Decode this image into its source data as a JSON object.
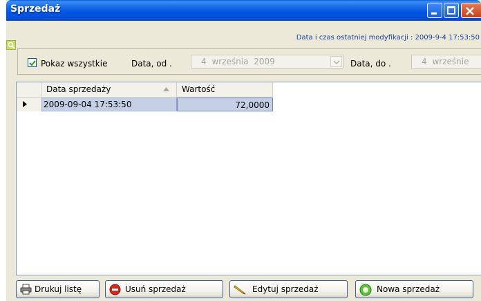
{
  "window": {
    "title": "Sprzedaż",
    "last_modified": "Data i czas ostatniej modyfikacji : 2009-9-4 17:53:50"
  },
  "filter": {
    "show_all_label": "Pokaz wszystkie",
    "show_all_checked": true,
    "date_from_label": "Data, od .",
    "date_from_value": "4 września 2009",
    "date_to_label": "Data, do .",
    "date_to_value": "4 wrześnie"
  },
  "grid": {
    "columns": [
      "Data sprzedaży",
      "Wartość"
    ],
    "rows": [
      {
        "date": "2009-09-04 17:53:50",
        "value": "72,0000",
        "selected": true
      }
    ]
  },
  "buttons": {
    "print": "Drukuj listę",
    "delete": "Usuń sprzedaż",
    "edit": "Edytuj sprzedaż",
    "new": "Nowa sprzedaż"
  },
  "icons": [
    "minimize-icon",
    "maximize-icon",
    "close-icon",
    "filter-search-icon",
    "checkbox-check-icon",
    "dropdown-arrow-icon",
    "sort-asc-icon",
    "row-pointer-icon",
    "printer-icon",
    "stop-icon",
    "pencil-icon",
    "add-icon"
  ],
  "colors": {
    "titlebar": "#0054e3",
    "window_bg": "#ece9d8",
    "selection": "#c4d0e6",
    "link_text": "#1a3f9c"
  }
}
